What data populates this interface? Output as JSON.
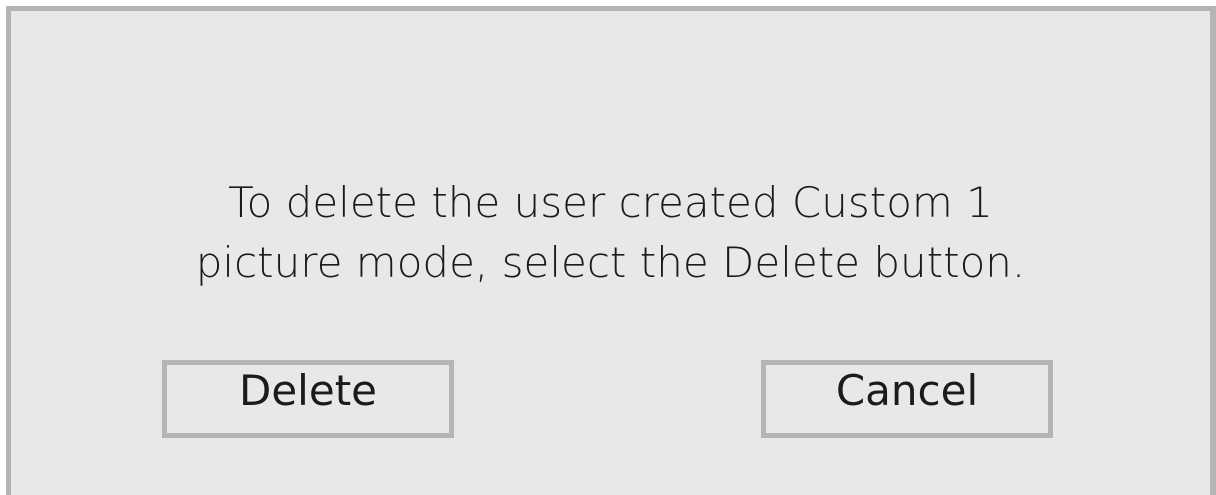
{
  "dialog": {
    "message_line1": "To delete the user created Custom 1",
    "message_line2": "picture mode, select the Delete button.",
    "delete_label": "Delete",
    "cancel_label": "Cancel"
  },
  "colors": {
    "background": "#e8e8e8",
    "border": "#b5b5b5",
    "text": "#1b1b1b"
  }
}
